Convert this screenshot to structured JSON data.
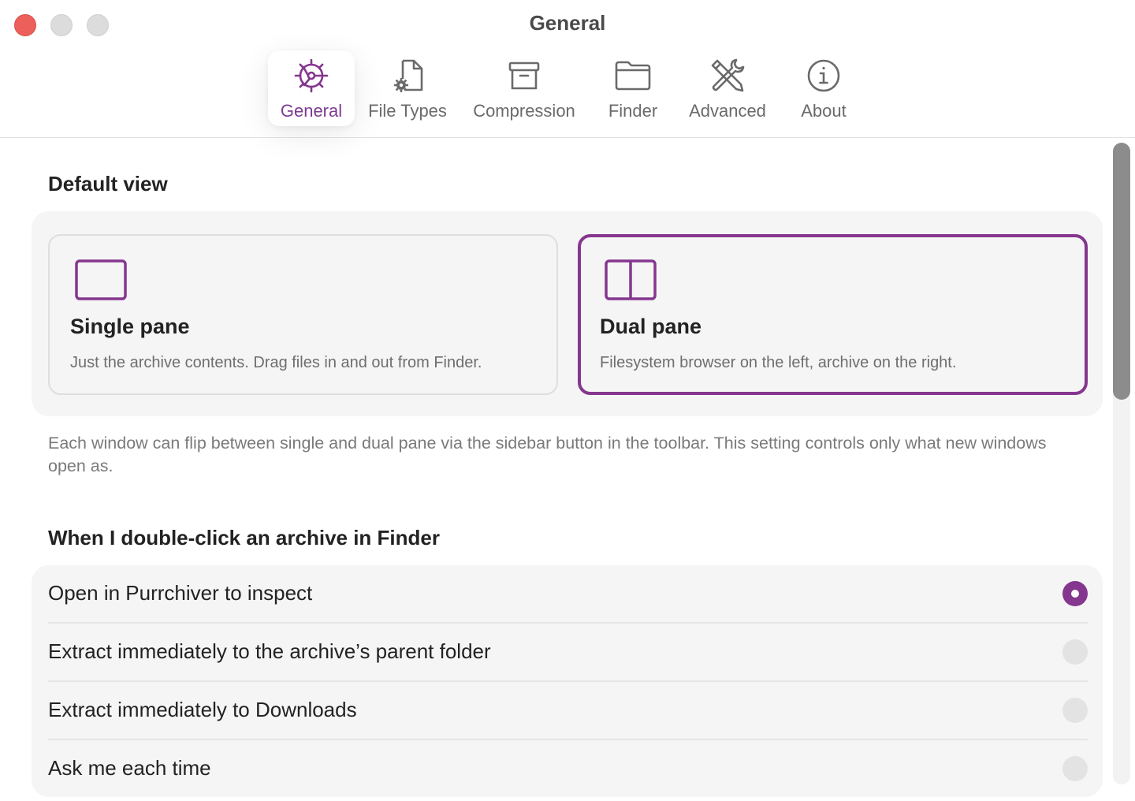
{
  "window": {
    "title": "General"
  },
  "tabs": [
    {
      "label": "General",
      "icon": "gear-icon",
      "active": true
    },
    {
      "label": "File Types",
      "icon": "document-gear-icon",
      "active": false
    },
    {
      "label": "Compression",
      "icon": "archive-box-icon",
      "active": false
    },
    {
      "label": "Finder",
      "icon": "folder-icon",
      "active": false
    },
    {
      "label": "Advanced",
      "icon": "tools-icon",
      "active": false
    },
    {
      "label": "About",
      "icon": "info-circle-icon",
      "active": false
    }
  ],
  "default_view": {
    "title": "Default view",
    "options": [
      {
        "title": "Single pane",
        "description": "Just the archive contents. Drag files in and out from Finder.",
        "icon": "single-pane-icon",
        "selected": false
      },
      {
        "title": "Dual pane",
        "description": "Filesystem browser on the left, archive on the right.",
        "icon": "dual-pane-icon",
        "selected": true
      }
    ],
    "note": "Each window can flip between single and dual pane via the sidebar button in the toolbar. This setting controls only what new windows open as."
  },
  "double_click": {
    "title": "When I double-click an archive in Finder",
    "options": [
      {
        "label": "Open in Purrchiver to inspect",
        "selected": true
      },
      {
        "label": "Extract immediately to the archive’s parent folder",
        "selected": false
      },
      {
        "label": "Extract immediately to Downloads",
        "selected": false
      },
      {
        "label": "Ask me each time",
        "selected": false
      }
    ]
  },
  "colors": {
    "accent": "#85368f",
    "background": "#ffffff",
    "group_bg": "#f5f5f5",
    "muted_text": "#6e6e6e"
  }
}
